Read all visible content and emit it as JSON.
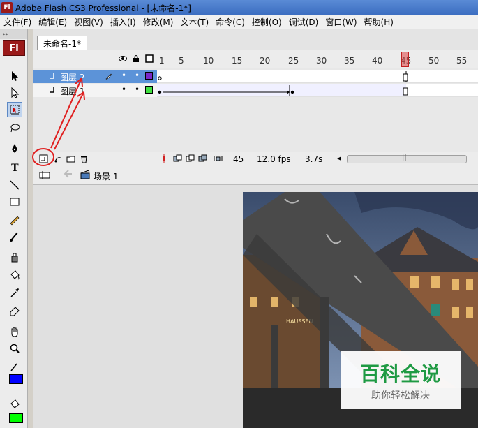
{
  "window": {
    "title": "Adobe Flash CS3 Professional - [未命名-1*]",
    "app_icon": "Fl"
  },
  "menu": [
    "文件(F)",
    "编辑(E)",
    "视图(V)",
    "插入(I)",
    "修改(M)",
    "文本(T)",
    "命令(C)",
    "控制(O)",
    "调试(D)",
    "窗口(W)",
    "帮助(H)"
  ],
  "tools": {
    "logo": "Fl",
    "stroke_color": "#0000ff",
    "fill_color": "#00ff00"
  },
  "document": {
    "tab_label": "未命名-1*"
  },
  "timeline": {
    "ticks": [
      "1",
      "5",
      "10",
      "15",
      "20",
      "25",
      "30",
      "35",
      "40",
      "45",
      "50",
      "55"
    ],
    "playhead_frame": 45,
    "layers": [
      {
        "name": "图层 2",
        "color": "#7a28c8",
        "selected": true
      },
      {
        "name": "图层 1",
        "color": "#40e040",
        "selected": false
      }
    ],
    "footer": {
      "frame": "45",
      "fps": "12.0 fps",
      "time": "3.7s"
    }
  },
  "scene": {
    "label": "场景 1"
  },
  "photo": {
    "sign_text": "HAUSSEN"
  },
  "watermark": {
    "main": "百科全说",
    "sub": "助你轻松解决"
  },
  "colors": {
    "selection": "#5c93d8",
    "annotation": "#e02020",
    "playhead": "#e05050"
  }
}
